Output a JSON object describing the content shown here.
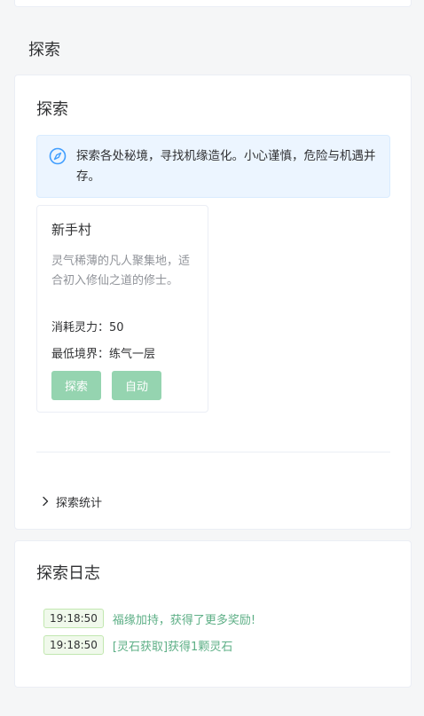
{
  "page": {
    "heading": "探索"
  },
  "explore_card": {
    "title": "探索",
    "alert_text": "探索各处秘境，寻找机缘造化。小心谨慎，危险与机遇并存。",
    "alert_icon": "compass-icon",
    "locations": [
      {
        "name": "新手村",
        "description": "灵气稀薄的凡人聚集地，适合初入修仙之道的修士。",
        "cost_text": "消耗灵力：50",
        "min_realm_text": "最低境界：练气一层",
        "explore_label": "探索",
        "auto_label": "自动"
      }
    ],
    "stats_toggle_label": "探索统计",
    "stats_icon": "chevron-right-icon"
  },
  "log_card": {
    "title": "探索日志",
    "entries": [
      {
        "time": "19:18:50",
        "text": "福缘加持，获得了更多奖励!"
      },
      {
        "time": "19:18:50",
        "text": "[灵石获取]获得1颗灵石"
      }
    ]
  },
  "colors": {
    "accent_button": "#95d4b0",
    "log_text": "#5daf86",
    "alert_bg": "#ecf5ff",
    "info_icon": "#409eff"
  }
}
